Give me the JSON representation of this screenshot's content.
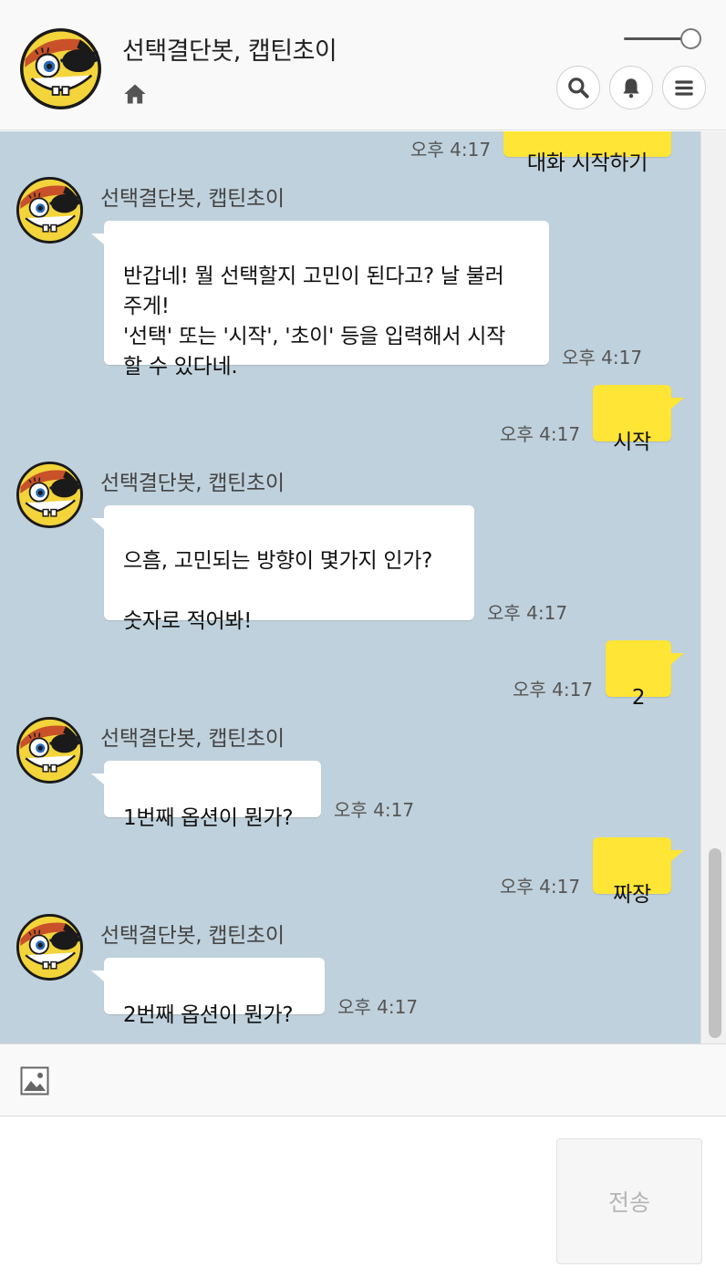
{
  "header": {
    "title": "선택결단봇, 캡틴초이",
    "home_icon": "home-icon",
    "search_icon": "search-icon",
    "bell_icon": "bell-icon",
    "menu_icon": "menu-icon"
  },
  "chat": {
    "top_partial": {
      "text": "대화 시작하기",
      "time": "오후 4:17"
    },
    "messages": [
      {
        "sender": "선택결단봇, 캡틴초이",
        "text": "반갑네! 뭘 선택할지 고민이 된다고? 날 불러\n주게!\n'선택' 또는 '시작', '초이' 등을 입력해서 시작\n할 수 있다네.",
        "time": "오후 4:17"
      },
      {
        "sender": "me",
        "text": "시작",
        "time": "오후 4:17"
      },
      {
        "sender": "선택결단봇, 캡틴초이",
        "text": "으흠, 고민되는 방향이 몇가지 인가?\n\n숫자로 적어봐!",
        "time": "오후 4:17"
      },
      {
        "sender": "me",
        "text": "2",
        "time": "오후 4:17"
      },
      {
        "sender": "선택결단봇, 캡틴초이",
        "text": "1번째 옵션이 뭔가?",
        "time": "오후 4:17"
      },
      {
        "sender": "me",
        "text": "짜장",
        "time": "오후 4:17"
      },
      {
        "sender": "선택결단봇, 캡틴초이",
        "text": "2번째 옵션이 뭔가?",
        "time": "오후 4:17"
      }
    ]
  },
  "composer": {
    "image_icon": "image-icon",
    "input_value": "",
    "send_label": "전송"
  },
  "colors": {
    "chat_bg": "#bfd1dc",
    "my_bubble": "#ffe535",
    "bot_bubble": "#ffffff",
    "header_bg": "#f9f9f9"
  }
}
